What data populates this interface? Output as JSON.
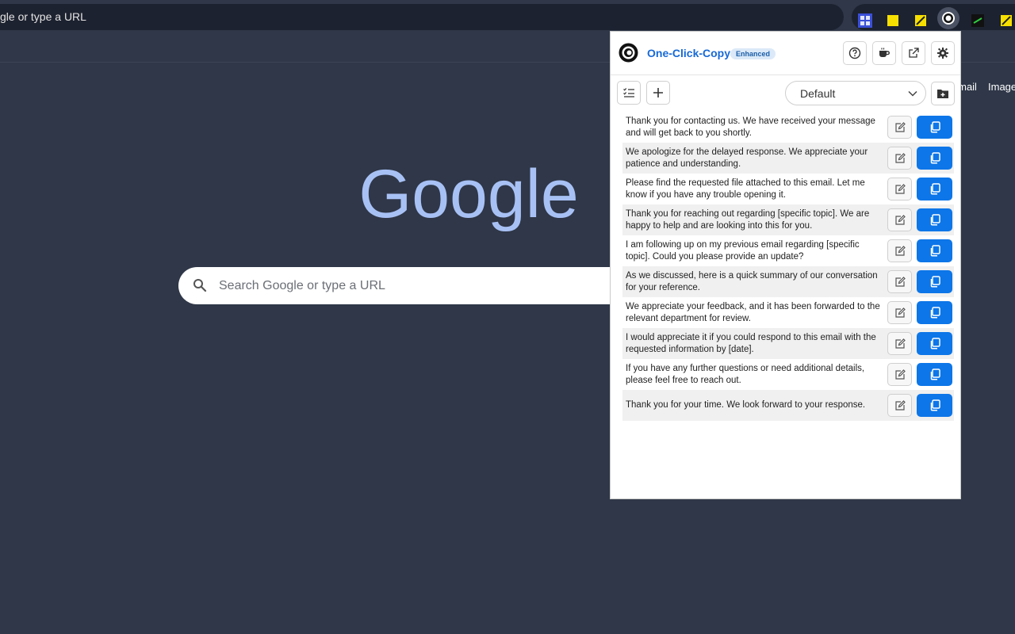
{
  "browser": {
    "omnibox_text": "gle or type a URL",
    "extensions": [
      "grid-extension-icon",
      "yellow-square-extension-icon",
      "yellow-note-extension-icon",
      "one-click-copy-extension-icon",
      "terminal-extension-icon",
      "yellow-note-extension-icon-2"
    ]
  },
  "ntp": {
    "links": [
      "Gmail",
      "Images"
    ],
    "logo_text": "Google",
    "search_placeholder": "Search Google or type a URL"
  },
  "popup": {
    "app_name": "One-Click-Copy",
    "badge": "Enhanced",
    "header_buttons": [
      "help-icon",
      "coffee-icon",
      "external-link-icon",
      "gear-icon"
    ],
    "category": "Default",
    "colors": {
      "accent": "#0d76e8",
      "brand": "#1769d6"
    },
    "snippets": [
      {
        "text": "Thank you for contacting us. We have received your message and will get back to you shortly."
      },
      {
        "text": "We apologize for the delayed response. We appreciate your patience and understanding."
      },
      {
        "text": "Please find the requested file attached to this email. Let me know if you have any trouble opening it."
      },
      {
        "text": "Thank you for reaching out regarding [specific topic]. We are happy to help and are looking into this for you."
      },
      {
        "text": "I am following up on my previous email regarding [specific topic]. Could you please provide an update?"
      },
      {
        "text": "As we discussed, here is a quick summary of our conversation for your reference."
      },
      {
        "text": "We appreciate your feedback, and it has been forwarded to the relevant department for review."
      },
      {
        "text": "I would appreciate it if you could respond to this email with the requested information by [date]."
      },
      {
        "text": "If you have any further questions or need additional details, please feel free to reach out."
      },
      {
        "text": "Thank you for your time. We look forward to your response."
      }
    ]
  }
}
